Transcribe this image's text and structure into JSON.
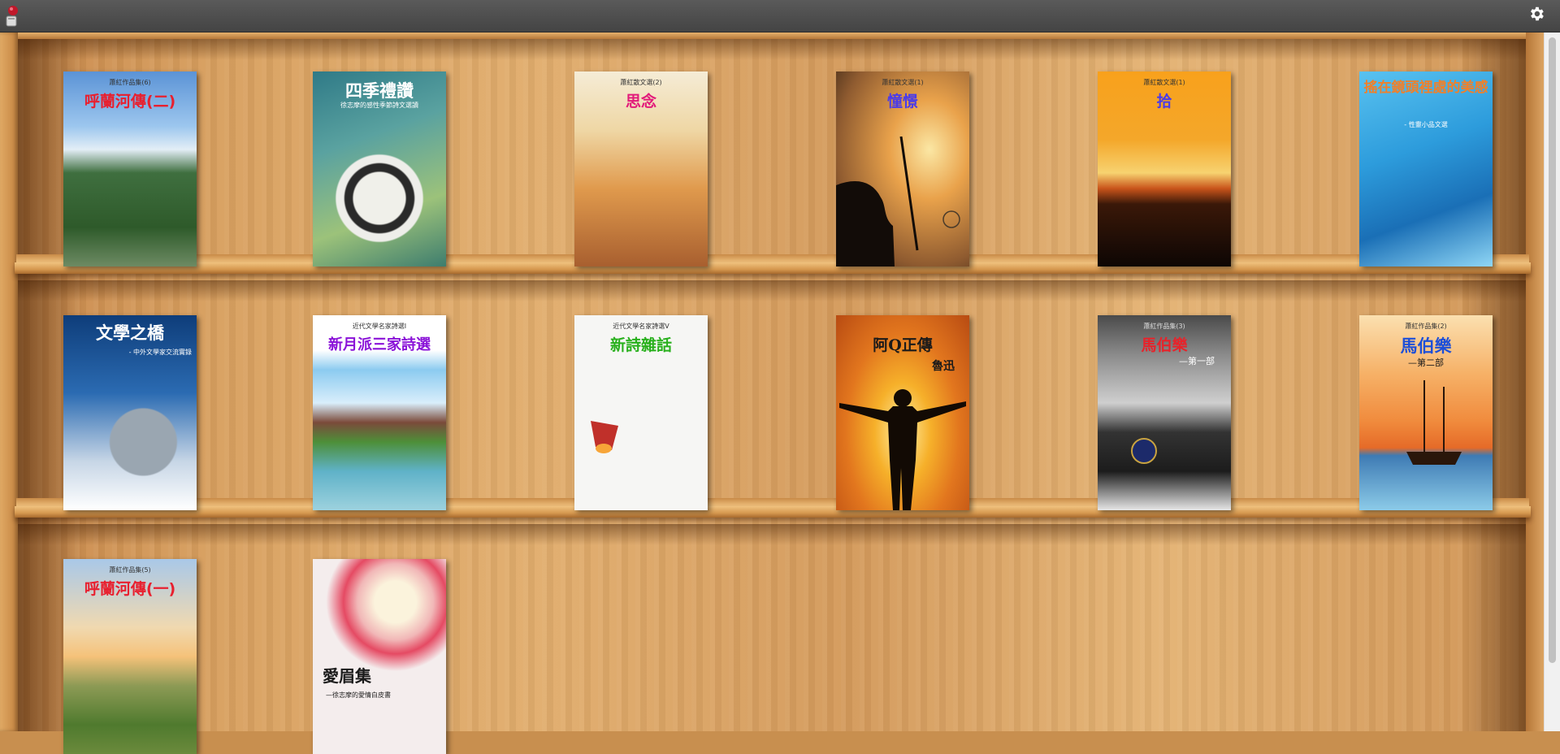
{
  "toolbar": {
    "logo_icon": "app-logo-icon",
    "settings_icon": "gear-icon"
  },
  "books": [
    {
      "series": "蕭紅作品集(6)",
      "title": "呼蘭河傳(二)",
      "subtitle": ""
    },
    {
      "series": "",
      "title": "四季禮讚",
      "subtitle": "徐志摩的感性季節詩文選讀"
    },
    {
      "series": "蕭紅散文選(2)",
      "title": "思念",
      "subtitle": ""
    },
    {
      "series": "蕭紅散文選(1)",
      "title": "憧憬",
      "subtitle": ""
    },
    {
      "series": "蕭紅散文選(1)",
      "title": "拾",
      "subtitle": ""
    },
    {
      "series": "",
      "title": "搖在鏡頭裡處的美感",
      "subtitle": "- 性靈小品文選"
    },
    {
      "series": "",
      "title": "文學之橋",
      "subtitle": "- 中外文學家交流實錄"
    },
    {
      "series": "近代文學名家詩選I",
      "title": "新月派三家詩選",
      "subtitle": ""
    },
    {
      "series": "近代文學名家詩選V",
      "title": "新詩雜話",
      "subtitle": ""
    },
    {
      "series": "",
      "title": "阿Q正傳",
      "subtitle": "魯迅"
    },
    {
      "series": "蕭紅作品集(3)",
      "title": "馬伯樂",
      "subtitle": "—第一部"
    },
    {
      "series": "蕭紅作品集(2)",
      "title": "馬伯樂",
      "subtitle": "—第二部"
    },
    {
      "series": "蕭紅作品集(5)",
      "title": "呼蘭河傳(一)",
      "subtitle": ""
    },
    {
      "series": "",
      "title": "愛眉集",
      "subtitle": "—徐志摩的愛情白皮書"
    }
  ]
}
